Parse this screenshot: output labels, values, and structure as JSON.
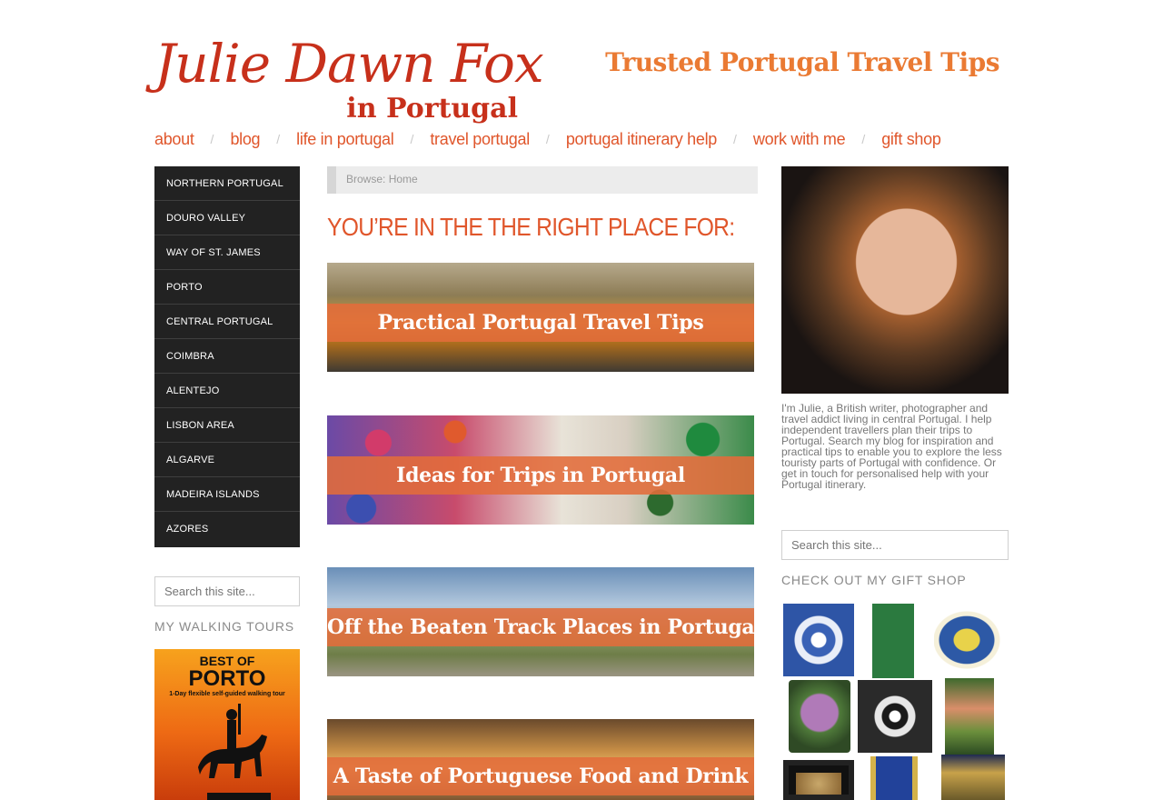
{
  "header": {
    "logo_script": "Julie Dawn Fox",
    "logo_sub": "in Portugal",
    "tagline": "Trusted Portugal Travel Tips"
  },
  "nav": {
    "items": [
      {
        "label": "about"
      },
      {
        "label": "blog"
      },
      {
        "label": "life in portugal"
      },
      {
        "label": "travel portugal"
      },
      {
        "label": "portugal itinerary help"
      },
      {
        "label": "work with me"
      },
      {
        "label": "gift shop"
      }
    ],
    "separator": "/"
  },
  "regions": [
    "NORTHERN PORTUGAL",
    "DOURO VALLEY",
    "WAY OF ST. JAMES",
    "PORTO",
    "CENTRAL PORTUGAL",
    "COIMBRA",
    "ALENTEJO",
    "LISBON AREA",
    "ALGARVE",
    "MADEIRA ISLANDS",
    "AZORES"
  ],
  "search": {
    "placeholder": "Search this site..."
  },
  "walking_tours": {
    "title": "MY WALKING TOURS",
    "card": {
      "line1": "BEST OF",
      "line2": "PORTO",
      "line3": "1-Day flexible self-guided walking tour"
    }
  },
  "breadcrumb": {
    "prefix": "Browse:",
    "current": "Home"
  },
  "main": {
    "heading": "YOU’RE IN THE THE RIGHT PLACE FOR:",
    "banners": [
      {
        "label": "Practical Portugal Travel Tips"
      },
      {
        "label": "Ideas for Trips in Portugal"
      },
      {
        "label": "Off the Beaten Track Places in Portugal"
      },
      {
        "label": "A Taste of Portuguese Food and Drink"
      }
    ]
  },
  "sidebar": {
    "bio": "I'm Julie, a British writer, photographer and travel addict living in central Portugal. I help independent travellers plan their trips to Portugal. Search my blog for inspiration and practical tips to enable you to explore the less touristy parts of Portugal with confidence. Or get in touch for personalised help with your Portugal itinerary.",
    "gift_title": "CHECK OUT MY GIFT SHOP"
  },
  "colors": {
    "brand_red": "#c7301b",
    "nav_orange": "#e0562b",
    "tagline_orange": "#ea7a33",
    "menu_dark": "#222222"
  }
}
